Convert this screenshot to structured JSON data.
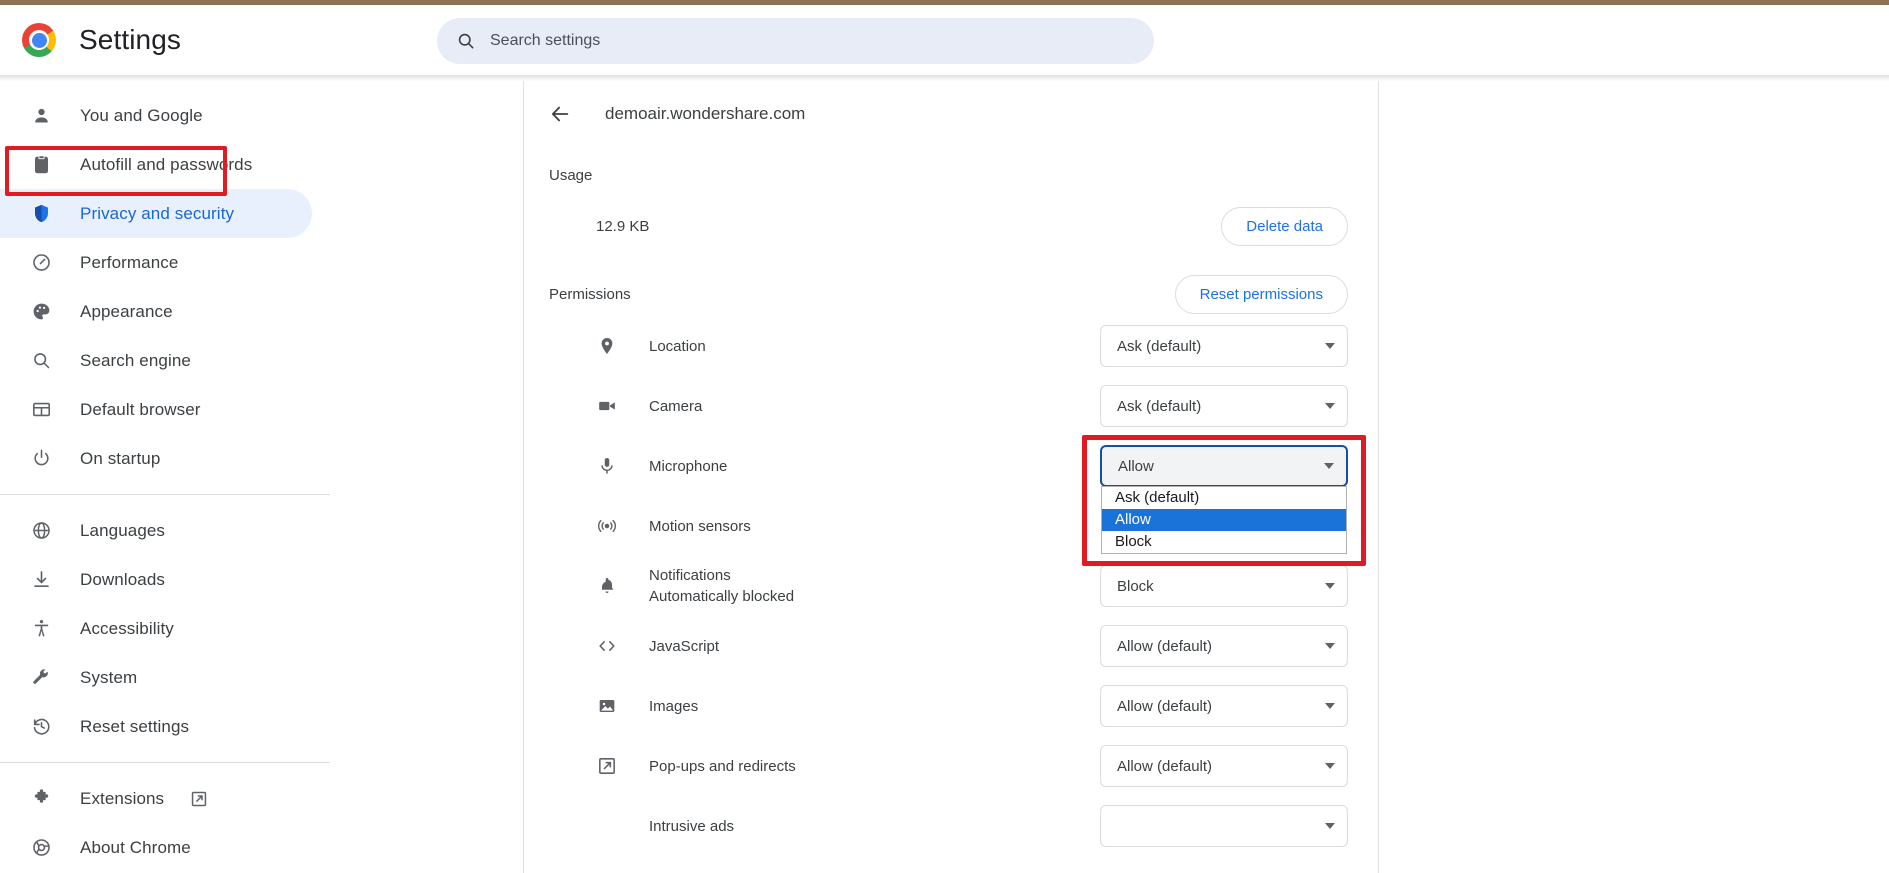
{
  "window": {
    "title": "Settings"
  },
  "search": {
    "placeholder": "Search settings",
    "icon": "search-icon"
  },
  "sidebar": {
    "groups": [
      {
        "items": [
          {
            "label": "You and Google",
            "icon": "person-icon",
            "selected": false
          },
          {
            "label": "Autofill and passwords",
            "icon": "clipboard-icon",
            "selected": false
          },
          {
            "label": "Privacy and security",
            "icon": "shield-icon",
            "selected": true
          },
          {
            "label": "Performance",
            "icon": "speedometer-icon",
            "selected": false
          },
          {
            "label": "Appearance",
            "icon": "palette-icon",
            "selected": false
          },
          {
            "label": "Search engine",
            "icon": "search-icon",
            "selected": false
          },
          {
            "label": "Default browser",
            "icon": "browser-window-icon",
            "selected": false
          },
          {
            "label": "On startup",
            "icon": "power-icon",
            "selected": false
          }
        ]
      },
      {
        "items": [
          {
            "label": "Languages",
            "icon": "globe-icon",
            "selected": false
          },
          {
            "label": "Downloads",
            "icon": "download-icon",
            "selected": false
          },
          {
            "label": "Accessibility",
            "icon": "accessibility-icon",
            "selected": false
          },
          {
            "label": "System",
            "icon": "wrench-icon",
            "selected": false
          },
          {
            "label": "Reset settings",
            "icon": "history-restore-icon",
            "selected": false
          }
        ]
      },
      {
        "items": [
          {
            "label": "Extensions",
            "icon": "puzzle-icon",
            "external": true,
            "selected": false
          },
          {
            "label": "About Chrome",
            "icon": "chrome-outline-icon",
            "selected": false
          }
        ]
      }
    ]
  },
  "main": {
    "back_icon": "arrow-left-icon",
    "site": "demoair.wondershare.com",
    "usage": {
      "title": "Usage",
      "value": "12.9 KB",
      "delete_button": "Delete data"
    },
    "permissions": {
      "title": "Permissions",
      "reset_button": "Reset permissions",
      "rows": [
        {
          "name": "Location",
          "icon": "location-pin-icon",
          "value": "Ask (default)",
          "state": "normal"
        },
        {
          "name": "Camera",
          "icon": "video-camera-icon",
          "value": "Ask (default)",
          "state": "normal"
        },
        {
          "name": "Microphone",
          "icon": "microphone-icon",
          "value": "Allow",
          "state": "open"
        },
        {
          "name": "Motion sensors",
          "icon": "motion-sensor-icon",
          "value": "",
          "state": "hidden"
        },
        {
          "name": "Notifications",
          "sub": "Automatically blocked",
          "icon": "bell-icon",
          "value": "Block",
          "state": "normal"
        },
        {
          "name": "JavaScript",
          "icon": "code-brackets-icon",
          "value": "Allow (default)",
          "state": "normal"
        },
        {
          "name": "Images",
          "icon": "image-icon",
          "value": "Allow (default)",
          "state": "normal"
        },
        {
          "name": "Pop-ups and redirects",
          "icon": "external-link-icon",
          "value": "Allow (default)",
          "state": "normal"
        },
        {
          "name": "Intrusive ads",
          "icon": "ads-icon",
          "value": "",
          "state": "cut"
        }
      ],
      "open_dropdown": {
        "options": [
          "Ask (default)",
          "Allow",
          "Block"
        ],
        "selected": "Allow"
      }
    }
  },
  "annotations": {
    "color": "#e01b24",
    "targets": [
      "sidebar-item-privacy-and-security",
      "microphone-permission-dropdown"
    ]
  }
}
